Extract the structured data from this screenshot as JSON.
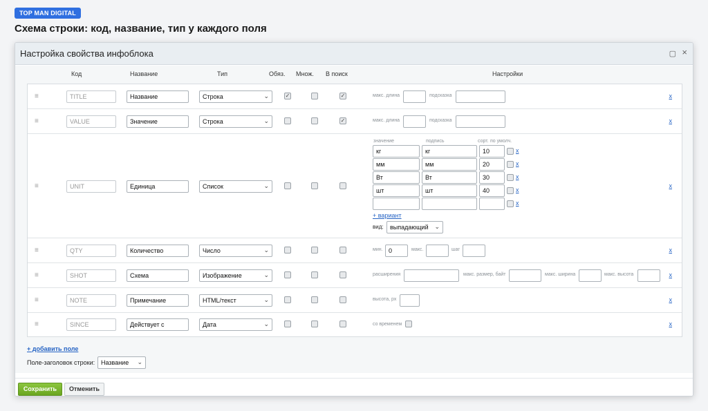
{
  "brand": "TOP MAN DIGITAL",
  "heading": "Схема строки: код, название, тип у каждого поля",
  "dialog": {
    "title": "Настройка свойства инфоблока",
    "restore_icon": "▢",
    "close_icon": "×"
  },
  "columns": {
    "code": "Код",
    "name": "Название",
    "type": "Тип",
    "required": "Обяз.",
    "multiple": "Множ.",
    "search": "В поиск",
    "settings": "Настройки"
  },
  "drag_glyph": "≡",
  "delete_label": "x",
  "rows": [
    {
      "code": "TITLE",
      "name": "Название",
      "type": "Строка",
      "required": true,
      "multiple": false,
      "search": true,
      "settings": {
        "max_len_label": "макс. длина",
        "max_len_value": "",
        "hint_label": "подсказка",
        "hint_value": ""
      }
    },
    {
      "code": "VALUE",
      "name": "Значение",
      "type": "Строка",
      "required": false,
      "multiple": false,
      "search": true,
      "settings": {
        "max_len_label": "макс. длина",
        "max_len_value": "",
        "hint_label": "подсказка",
        "hint_value": ""
      }
    },
    {
      "code": "UNIT",
      "name": "Единица",
      "type": "Список",
      "required": false,
      "multiple": false,
      "search": false,
      "settings": {
        "headers": {
          "value": "значение",
          "caption": "подпись",
          "sort": "сорт.",
          "default": "по умолч."
        },
        "options": [
          {
            "value": "кг",
            "caption": "кг",
            "sort": "10"
          },
          {
            "value": "мм",
            "caption": "мм",
            "sort": "20"
          },
          {
            "value": "Вт",
            "caption": "Вт",
            "sort": "30"
          },
          {
            "value": "шт",
            "caption": "шт",
            "sort": "40"
          },
          {
            "value": "",
            "caption": "",
            "sort": ""
          }
        ],
        "add_variant": "+ вариант",
        "view_label": "вид:",
        "view_value": "выпадающий"
      }
    },
    {
      "code": "QTY",
      "name": "Количество",
      "type": "Число",
      "required": false,
      "multiple": false,
      "search": false,
      "settings": {
        "min_label": "мин.",
        "min_value": "0",
        "max_label": "макс.",
        "max_value": "",
        "step_label": "шаг",
        "step_value": ""
      }
    },
    {
      "code": "SHOT",
      "name": "Схема",
      "type": "Изображение",
      "required": false,
      "multiple": false,
      "search": false,
      "settings": {
        "ext_label": "расширения",
        "ext_value": "",
        "size_label": "макс. размер, байт",
        "size_value": "",
        "width_label": "макс. ширина",
        "width_value": "",
        "height_label": "макс. высота",
        "height_value": ""
      }
    },
    {
      "code": "NOTE",
      "name": "Примечание",
      "type": "HTML/текст",
      "required": false,
      "multiple": false,
      "search": false,
      "settings": {
        "height_label": "высота, px",
        "height_value": ""
      }
    },
    {
      "code": "SINCE",
      "name": "Действует с",
      "type": "Дата",
      "required": false,
      "multiple": false,
      "search": false,
      "settings": {
        "time_label": "со временем",
        "time_value": false
      }
    }
  ],
  "add_field": "+ добавить поле",
  "header_field_label": "Поле-заголовок строки:",
  "header_field_value": "Название",
  "buttons": {
    "save": "Сохранить",
    "cancel": "Отменить"
  }
}
